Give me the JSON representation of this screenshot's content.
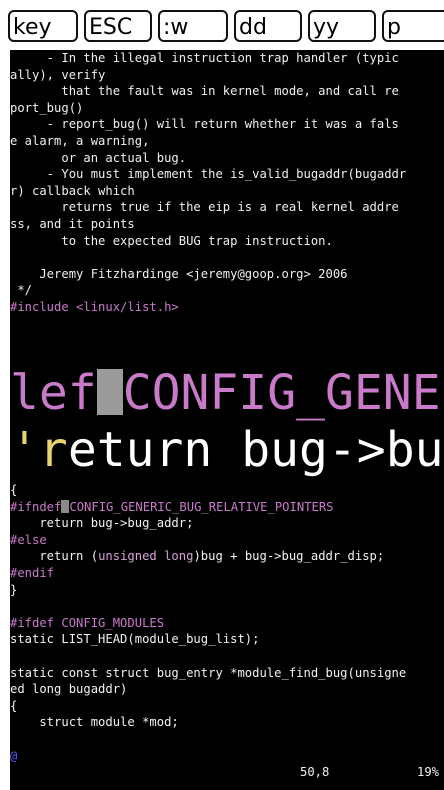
{
  "keys": [
    "key",
    "ESC",
    ":w",
    "dd",
    "yy",
    "p"
  ],
  "code_top": [
    "     - In the illegal instruction trap handler (typic",
    "ally), verify",
    "       that the fault was in kernel mode, and call re",
    "port_bug()",
    "     - report_bug() will return whether it was a fals",
    "e alarm, a warning,",
    "       or an actual bug.",
    "     - You must implement the is_valid_bugaddr(bugaddr",
    "r) callback which",
    "       returns true if the eip is a real kernel addre",
    "ss, and it points",
    "       to the expected BUG trap instruction.",
    "",
    "    Jeremy Fitzhardinge <jeremy@goop.org> 2006",
    " */",
    "#include <linux/list.h>"
  ],
  "zoom": {
    "line1_prefix": "lef",
    "line1_rest": "CONFIG_GENERIC_",
    "line2_prefix": "'",
    "line2_rest": "eturn bug->bug_add"
  },
  "code_bottom": [
    "{",
    "#ifndef CONFIG_GENERIC_BUG_RELATIVE_POINTERS",
    "    return bug->bug_addr;",
    "#else",
    "    return (unsigned long)bug + bug->bug_addr_disp;",
    "#endif",
    "}",
    "",
    "#ifdef CONFIG_MODULES",
    "static LIST_HEAD(module_bug_list);",
    "",
    "static const struct bug_entry *module_find_bug(unsigne",
    "ed long bugaddr)",
    "{",
    "    struct module *mod;",
    "",
    "@"
  ],
  "status": {
    "position": "50,8",
    "percent": "19%"
  }
}
